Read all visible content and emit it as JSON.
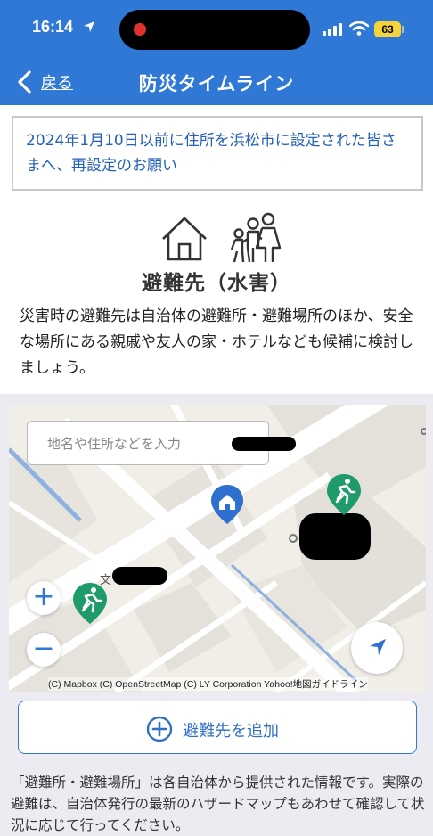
{
  "status_bar": {
    "time": "16:14",
    "battery": "63"
  },
  "nav": {
    "back_label": "戻る",
    "title": "防災タイムライン"
  },
  "notice": {
    "text": "2024年1月10日以前に住所を浜松市に設定された皆さまへ、再設定のお願い"
  },
  "section": {
    "title": "避難先（水害）",
    "description": "災害時の避難先は自治体の避難所・避難場所のほか、安全な場所にある親戚や友人の家・ホテルなども候補に検討しましょう。",
    "icons": [
      "house-icon",
      "family-icon"
    ]
  },
  "map": {
    "search_placeholder": "地名や住所などを入力",
    "school_glyph": "文",
    "zoom_in": "+",
    "zoom_out": "−",
    "attribution": "(C) Mapbox (C) OpenStreetMap (C) LY Corporation Yahoo!地図ガイドライン",
    "markers": [
      "home-pin-icon",
      "evacuation-pin-icon",
      "evacuation-pin-icon"
    ]
  },
  "add_button": {
    "label": "避難先を追加"
  },
  "footer": {
    "note": "「避難所・避難場所」は各自治体から提供された情報です。実際の避難は、自治体発行の最新のハザードマップもあわせて確認して状況に応じて行ってください。"
  },
  "colors": {
    "header_blue": "#2f78d6",
    "link_blue": "#2460b8",
    "evac_green": "#1f9a6a",
    "map_bg": "#f1eee8"
  }
}
